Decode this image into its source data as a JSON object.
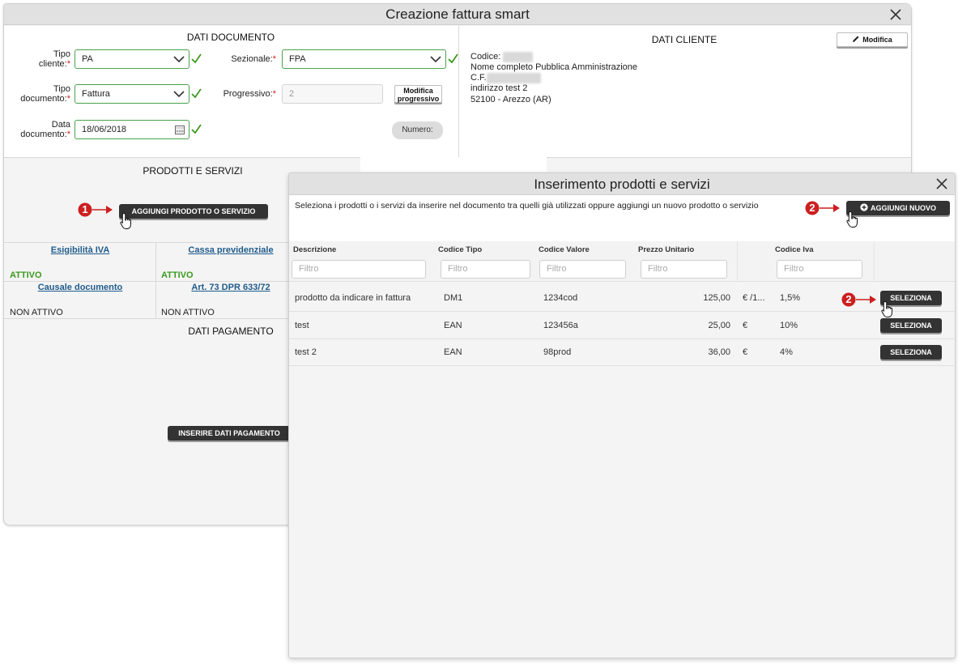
{
  "main_dialog": {
    "title": "Creazione fattura smart",
    "documento": {
      "section_title": "DATI DOCUMENTO",
      "tipo_cliente_label": "Tipo cliente:",
      "tipo_cliente_value": "PA",
      "sezionale_label": "Sezionale:",
      "sezionale_value": "FPA",
      "tipo_documento_label": "Tipo documento:",
      "tipo_documento_value": "Fattura",
      "progressivo_label": "Progressivo:",
      "progressivo_value": "2",
      "modifica_progressivo": "Modifica progressivo",
      "data_documento_label": "Data documento:",
      "data_documento_value": "18/06/2018",
      "numero_button": "Numero:"
    },
    "cliente": {
      "section_title": "DATI CLIENTE",
      "modifica_button": "Modifica",
      "codice_label": "Codice:",
      "codice_value": "000000",
      "nome": "Nome completo Pubblica Amministrazione",
      "cf_label": "C.F.",
      "cf_value": "01234567891",
      "indirizzo": "indirizzo test 2",
      "citta": "52100 - Arezzo (AR)"
    },
    "prodotti": {
      "section_title": "PRODOTTI E SERVIZI",
      "add_button": "AGGIUNGI PRODOTTO O SERVIZIO"
    },
    "options": {
      "esigibilita_label": "Esigibilità IVA",
      "esigibilita_state": "ATTIVO",
      "cassa_label": "Cassa previdenziale",
      "cassa_state": "ATTIVO",
      "causale_label": "Causale documento",
      "causale_state": "NON ATTIVO",
      "art73_label": "Art. 73 DPR 633/72",
      "art73_state": "NON ATTIVO"
    },
    "pagamento": {
      "section_title": "DATI PAGAMENTO",
      "button": "INSERIRE DATI PAGAMENTO"
    }
  },
  "product_dialog": {
    "title": "Inserimento prodotti e servizi",
    "description": "Seleziona i prodotti o i servizi da inserire nel documento tra quelli già utilizzati oppure aggiungi un nuovo prodotto o servizio",
    "add_new_button": "AGGIUNGI NUOVO",
    "columns": [
      "Descrizione",
      "Codice Tipo",
      "Codice Valore",
      "Prezzo Unitario",
      "Codice Iva"
    ],
    "filter_placeholder": "Filtro",
    "select_label": "SELEZIONA",
    "rows": [
      {
        "descrizione": "prodotto da indicare in fattura",
        "codice_tipo": "DM1",
        "codice_valore": "1234cod",
        "prezzo": "125,00",
        "valuta": "€ /1...",
        "iva": "1,5%"
      },
      {
        "descrizione": "test",
        "codice_tipo": "EAN",
        "codice_valore": "123456a",
        "prezzo": "25,00",
        "valuta": "€",
        "iva": "10%"
      },
      {
        "descrizione": "test 2",
        "codice_tipo": "EAN",
        "codice_valore": "98prod",
        "prezzo": "36,00",
        "valuta": "€",
        "iva": "4%"
      }
    ]
  },
  "annotations": {
    "step1": "1",
    "step2": "2",
    "marker_color": "#cc1f1f"
  }
}
